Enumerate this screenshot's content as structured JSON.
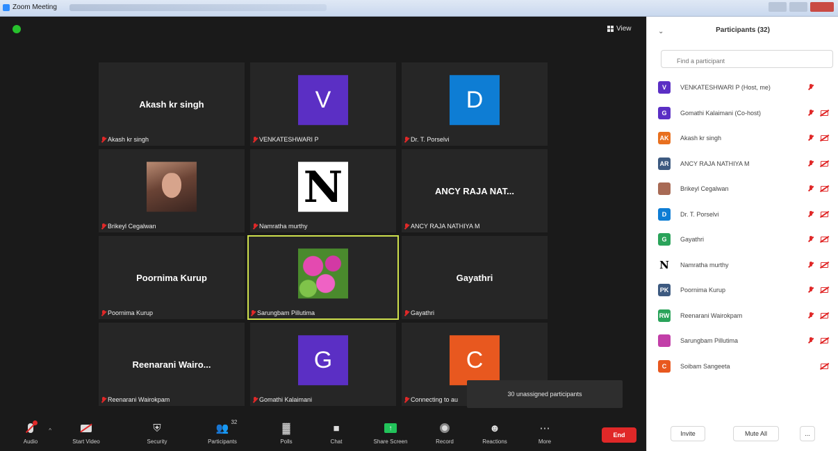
{
  "window": {
    "title": "Zoom Meeting"
  },
  "meeting": {
    "view_label": "View"
  },
  "tiles": [
    {
      "big_name": "Akash kr singh",
      "label": "Akash kr singh"
    },
    {
      "avatar_letter": "V",
      "avatar_color": "#5b2fc4",
      "label": "VENKATESHWARI P"
    },
    {
      "avatar_letter": "D",
      "avatar_color": "#0e7dd4",
      "label": "Dr. T. Porselvi"
    },
    {
      "photo": "woman",
      "label": "Brikeyl Cegalwan"
    },
    {
      "photo": "n-logo",
      "photo_letter": "N",
      "label": "Namratha murthy"
    },
    {
      "big_name": "ANCY RAJA NAT...",
      "label": "ANCY RAJA NATHIYA M"
    },
    {
      "big_name": "Poornima Kurup",
      "label": "Poornima Kurup"
    },
    {
      "photo": "flowers",
      "label": "Sarungbam Pillutima",
      "active": true
    },
    {
      "big_name": "Gayathri",
      "label": "Gayathri"
    },
    {
      "big_name": "Reenarani Wairo...",
      "label": "Reenarani Wairokpam"
    },
    {
      "avatar_letter": "G",
      "avatar_color": "#5b2fc4",
      "label": "Gomathi Kalaimani"
    },
    {
      "avatar_letter": "C",
      "avatar_color": "#e8581f",
      "label": "Connecting to au"
    }
  ],
  "tooltip": "30 unassigned participants",
  "toolbar": {
    "audio": "Audio",
    "start_video": "Start Video",
    "security": "Security",
    "participants": "Participants",
    "participants_count": "32",
    "polls": "Polls",
    "chat": "Chat",
    "share_screen": "Share Screen",
    "record": "Record",
    "reactions": "Reactions",
    "more": "More",
    "end": "End"
  },
  "panel": {
    "title": "Participants (32)",
    "search_placeholder": "Find a participant",
    "invite": "Invite",
    "mute_all": "Mute All",
    "more": "..."
  },
  "participants": [
    {
      "initials": "V",
      "color": "#5b2fc4",
      "name": "VENKATESHWARI P (Host, me)",
      "cam": false
    },
    {
      "initials": "G",
      "color": "#5b2fc4",
      "name": "Gomathi Kalaimani (Co-host)",
      "cam": true
    },
    {
      "initials": "AK",
      "color": "#e8701f",
      "name": "Akash kr singh",
      "cam": true
    },
    {
      "initials": "AR",
      "color": "#3d5a80",
      "name": "ANCY RAJA NATHIYA M",
      "cam": true
    },
    {
      "initials": "",
      "color": "#a86a55",
      "name": "Brikeyl Cegalwan",
      "cam": true
    },
    {
      "initials": "D",
      "color": "#0e7dd4",
      "name": "Dr. T. Porselvi",
      "cam": true
    },
    {
      "initials": "G",
      "color": "#2aa35a",
      "name": "Gayathri",
      "cam": true
    },
    {
      "initials": "N",
      "color": "#ffffff",
      "name": "Namratha murthy",
      "cam": true
    },
    {
      "initials": "PK",
      "color": "#3d5a80",
      "name": "Poornima Kurup",
      "cam": true
    },
    {
      "initials": "RW",
      "color": "#2aa35a",
      "name": "Reenarani Wairokpam",
      "cam": true
    },
    {
      "initials": "",
      "color": "#c23fa8",
      "name": "Sarungbam Pillutima",
      "cam": true
    },
    {
      "initials": "C",
      "color": "#e8581f",
      "name": "Soibam Sangeeta",
      "cam": true,
      "mic": false
    }
  ]
}
